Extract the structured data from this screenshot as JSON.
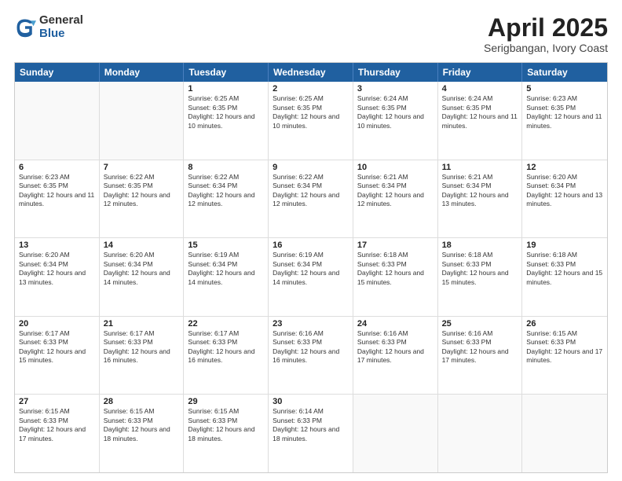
{
  "logo": {
    "general": "General",
    "blue": "Blue"
  },
  "title": "April 2025",
  "subtitle": "Serigbangan, Ivory Coast",
  "header_days": [
    "Sunday",
    "Monday",
    "Tuesday",
    "Wednesday",
    "Thursday",
    "Friday",
    "Saturday"
  ],
  "rows": [
    [
      {
        "day": "",
        "info": ""
      },
      {
        "day": "",
        "info": ""
      },
      {
        "day": "1",
        "info": "Sunrise: 6:25 AM\nSunset: 6:35 PM\nDaylight: 12 hours and 10 minutes."
      },
      {
        "day": "2",
        "info": "Sunrise: 6:25 AM\nSunset: 6:35 PM\nDaylight: 12 hours and 10 minutes."
      },
      {
        "day": "3",
        "info": "Sunrise: 6:24 AM\nSunset: 6:35 PM\nDaylight: 12 hours and 10 minutes."
      },
      {
        "day": "4",
        "info": "Sunrise: 6:24 AM\nSunset: 6:35 PM\nDaylight: 12 hours and 11 minutes."
      },
      {
        "day": "5",
        "info": "Sunrise: 6:23 AM\nSunset: 6:35 PM\nDaylight: 12 hours and 11 minutes."
      }
    ],
    [
      {
        "day": "6",
        "info": "Sunrise: 6:23 AM\nSunset: 6:35 PM\nDaylight: 12 hours and 11 minutes."
      },
      {
        "day": "7",
        "info": "Sunrise: 6:22 AM\nSunset: 6:35 PM\nDaylight: 12 hours and 12 minutes."
      },
      {
        "day": "8",
        "info": "Sunrise: 6:22 AM\nSunset: 6:34 PM\nDaylight: 12 hours and 12 minutes."
      },
      {
        "day": "9",
        "info": "Sunrise: 6:22 AM\nSunset: 6:34 PM\nDaylight: 12 hours and 12 minutes."
      },
      {
        "day": "10",
        "info": "Sunrise: 6:21 AM\nSunset: 6:34 PM\nDaylight: 12 hours and 12 minutes."
      },
      {
        "day": "11",
        "info": "Sunrise: 6:21 AM\nSunset: 6:34 PM\nDaylight: 12 hours and 13 minutes."
      },
      {
        "day": "12",
        "info": "Sunrise: 6:20 AM\nSunset: 6:34 PM\nDaylight: 12 hours and 13 minutes."
      }
    ],
    [
      {
        "day": "13",
        "info": "Sunrise: 6:20 AM\nSunset: 6:34 PM\nDaylight: 12 hours and 13 minutes."
      },
      {
        "day": "14",
        "info": "Sunrise: 6:20 AM\nSunset: 6:34 PM\nDaylight: 12 hours and 14 minutes."
      },
      {
        "day": "15",
        "info": "Sunrise: 6:19 AM\nSunset: 6:34 PM\nDaylight: 12 hours and 14 minutes."
      },
      {
        "day": "16",
        "info": "Sunrise: 6:19 AM\nSunset: 6:34 PM\nDaylight: 12 hours and 14 minutes."
      },
      {
        "day": "17",
        "info": "Sunrise: 6:18 AM\nSunset: 6:33 PM\nDaylight: 12 hours and 15 minutes."
      },
      {
        "day": "18",
        "info": "Sunrise: 6:18 AM\nSunset: 6:33 PM\nDaylight: 12 hours and 15 minutes."
      },
      {
        "day": "19",
        "info": "Sunrise: 6:18 AM\nSunset: 6:33 PM\nDaylight: 12 hours and 15 minutes."
      }
    ],
    [
      {
        "day": "20",
        "info": "Sunrise: 6:17 AM\nSunset: 6:33 PM\nDaylight: 12 hours and 15 minutes."
      },
      {
        "day": "21",
        "info": "Sunrise: 6:17 AM\nSunset: 6:33 PM\nDaylight: 12 hours and 16 minutes."
      },
      {
        "day": "22",
        "info": "Sunrise: 6:17 AM\nSunset: 6:33 PM\nDaylight: 12 hours and 16 minutes."
      },
      {
        "day": "23",
        "info": "Sunrise: 6:16 AM\nSunset: 6:33 PM\nDaylight: 12 hours and 16 minutes."
      },
      {
        "day": "24",
        "info": "Sunrise: 6:16 AM\nSunset: 6:33 PM\nDaylight: 12 hours and 17 minutes."
      },
      {
        "day": "25",
        "info": "Sunrise: 6:16 AM\nSunset: 6:33 PM\nDaylight: 12 hours and 17 minutes."
      },
      {
        "day": "26",
        "info": "Sunrise: 6:15 AM\nSunset: 6:33 PM\nDaylight: 12 hours and 17 minutes."
      }
    ],
    [
      {
        "day": "27",
        "info": "Sunrise: 6:15 AM\nSunset: 6:33 PM\nDaylight: 12 hours and 17 minutes."
      },
      {
        "day": "28",
        "info": "Sunrise: 6:15 AM\nSunset: 6:33 PM\nDaylight: 12 hours and 18 minutes."
      },
      {
        "day": "29",
        "info": "Sunrise: 6:15 AM\nSunset: 6:33 PM\nDaylight: 12 hours and 18 minutes."
      },
      {
        "day": "30",
        "info": "Sunrise: 6:14 AM\nSunset: 6:33 PM\nDaylight: 12 hours and 18 minutes."
      },
      {
        "day": "",
        "info": ""
      },
      {
        "day": "",
        "info": ""
      },
      {
        "day": "",
        "info": ""
      }
    ]
  ]
}
